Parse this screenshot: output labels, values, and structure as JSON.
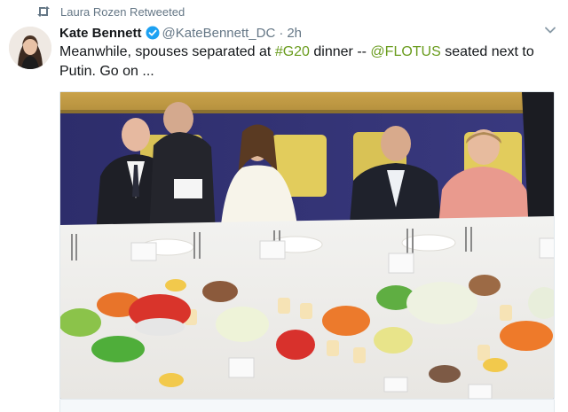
{
  "retweet": {
    "label": "Laura Rozen Retweeted",
    "icon": "retweet-icon"
  },
  "tweet": {
    "author_name": "Kate Bennett",
    "verified_icon": "verified-badge-icon",
    "handle": "@KateBennett_DC",
    "separator": "·",
    "time": "2h",
    "text_parts": {
      "p1": "Meanwhile, spouses separated at ",
      "hashtag": "#G20",
      "p2": " dinner -- ",
      "mention": "@FLOTUS",
      "p3": " seated next to Putin. Go on ..."
    },
    "menu_icon": "chevron-down-icon"
  },
  "colors": {
    "link": "#6a9c1e",
    "secondary_text": "#657786",
    "primary_text": "#14171a",
    "verified": "#1da1f2"
  }
}
